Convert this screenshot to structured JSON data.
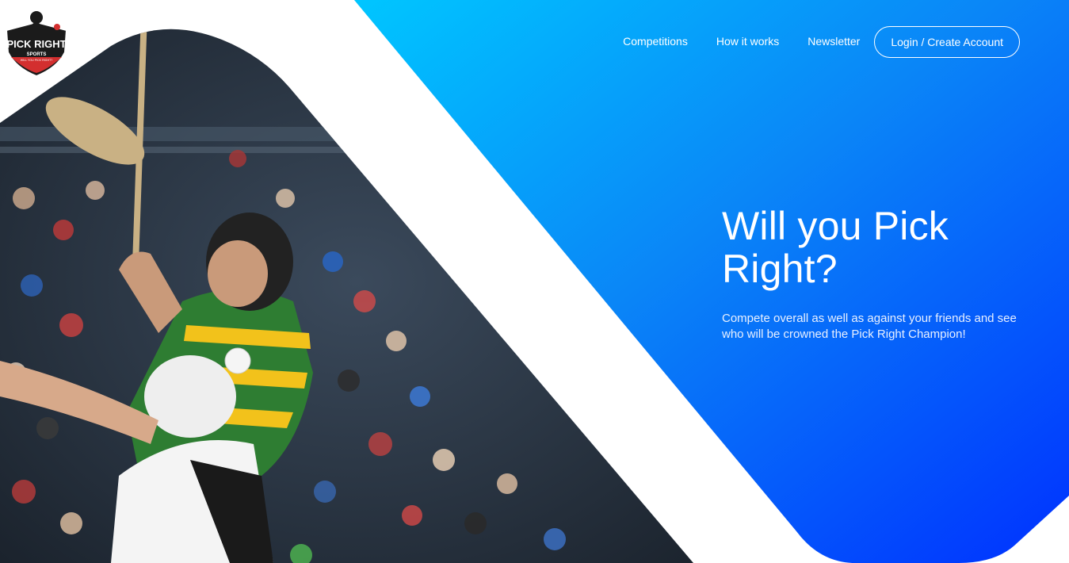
{
  "brand": {
    "name": "PICK RIGHT",
    "sub": "SPORTS",
    "tagline": "WILL YOU PICK RIGHT?"
  },
  "nav": {
    "items": [
      {
        "label": "Competitions"
      },
      {
        "label": "How it works"
      },
      {
        "label": "Newsletter"
      }
    ],
    "login_label": "Login / Create Account"
  },
  "hero": {
    "title": "Will you Pick Right?",
    "subtitle": "Compete overall as well as against your friends and see who will be crowned the Pick Right Champion!"
  },
  "colors": {
    "gradient_start": "#00c2ff",
    "gradient_mid": "#0a7cf5",
    "gradient_end": "#0033ff",
    "text": "#ffffff"
  },
  "images": {
    "hero_photo": "hurling-players-photo",
    "logo": "pick-right-sports-logo"
  }
}
